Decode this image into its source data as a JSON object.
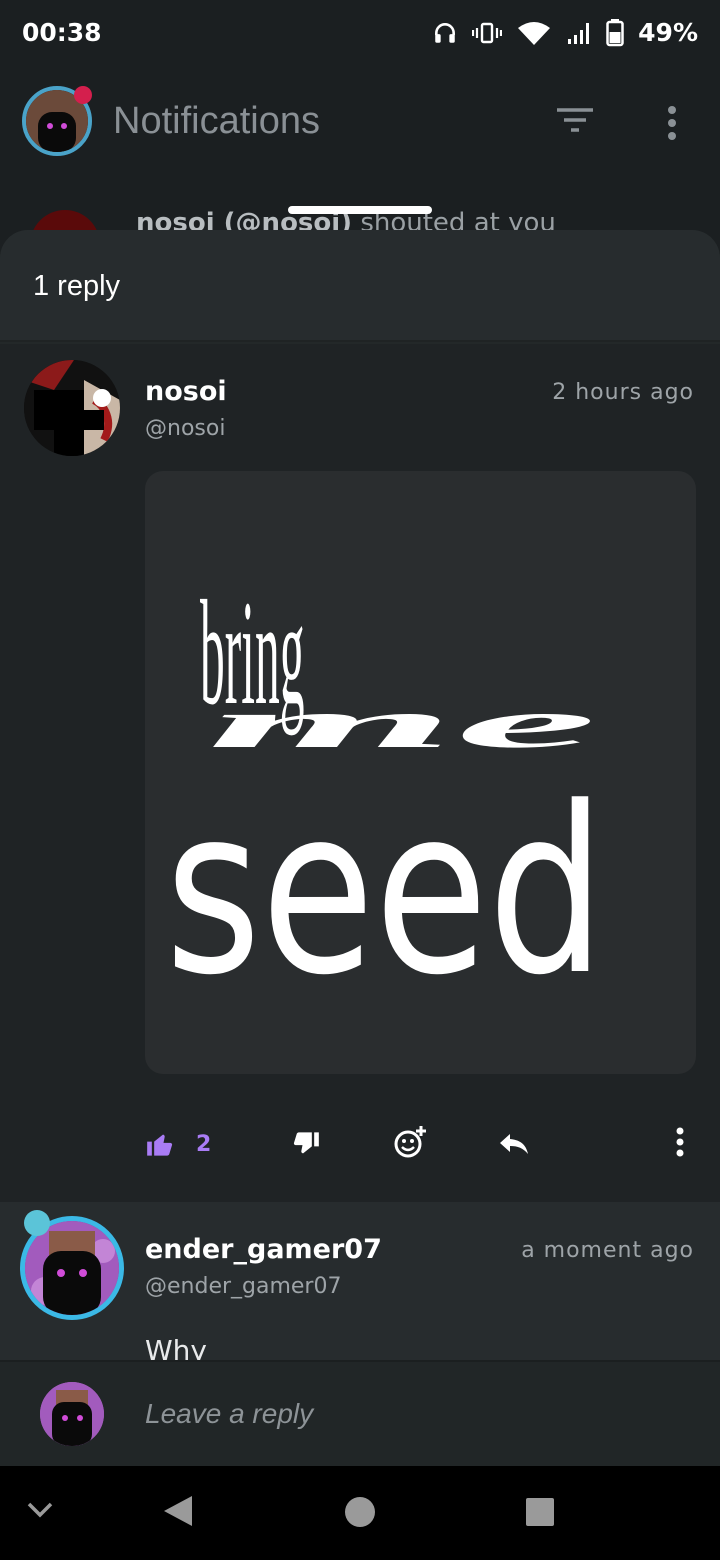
{
  "status_bar": {
    "time": "00:38",
    "battery": "49%",
    "icons": [
      "headphones-icon",
      "vibrate-icon",
      "wifi-icon",
      "signal-icon",
      "battery-icon"
    ]
  },
  "app_bar": {
    "title": "Notifications",
    "icons": [
      "filter-icon",
      "more-vert-icon"
    ]
  },
  "background_notification": {
    "name": "nosoi (@nosoi)",
    "text": " shouted at you"
  },
  "sheet": {
    "title": "1 reply"
  },
  "post": {
    "name": "nosoi",
    "handle": "@nosoi",
    "time": "2 hours ago",
    "image_text": {
      "line1": "bring",
      "line2": "me",
      "line3": "seed"
    },
    "likes": "2",
    "actions": [
      "like-icon",
      "dislike-icon",
      "add-reaction-icon",
      "reply-icon",
      "more-vert-icon"
    ]
  },
  "reply": {
    "name": "ender_gamer07",
    "handle": "@ender_gamer07",
    "time": "a moment ago",
    "text": "Why"
  },
  "composer": {
    "placeholder": "Leave a reply"
  },
  "nav_bar": {
    "icons": [
      "chevron-down-icon",
      "back-icon",
      "home-icon",
      "recents-icon"
    ]
  },
  "colors": {
    "accent": "#a97cf5",
    "background": "#1c2022",
    "sheet": "#232829"
  }
}
